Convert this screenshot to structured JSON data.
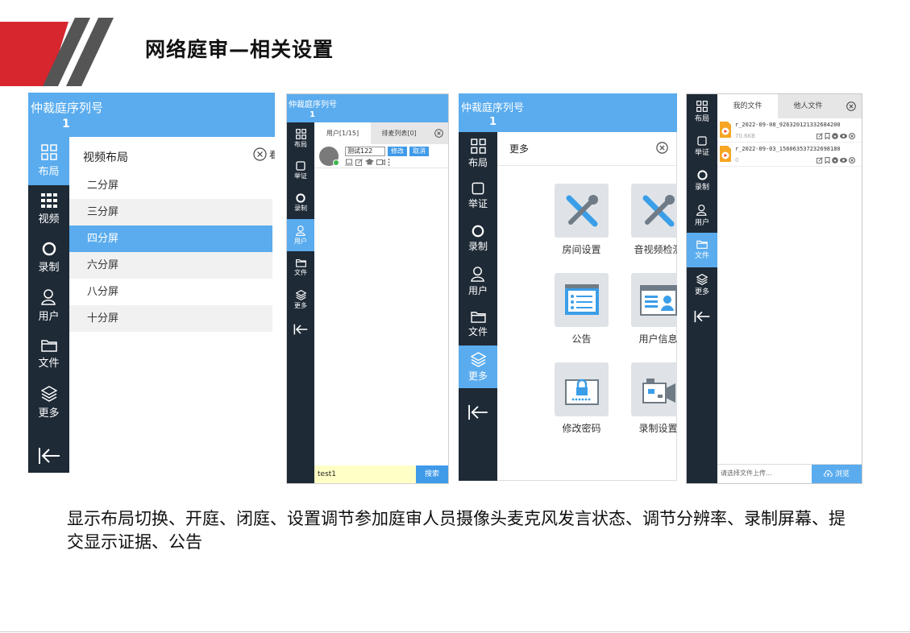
{
  "slide": {
    "title": "网络庭审—相关设置",
    "caption": "显示布局切换、开庭、闭庭、设置调节参加庭审人员摄像头麦克风发言状态、调节分辨率、录制屏幕、提交显示证据、公告",
    "accent_red": "#d7262e",
    "accent_gray": "#555555"
  },
  "p1": {
    "header_title": "仲裁庭序列号",
    "header_number": "1",
    "nav": [
      "布局",
      "视频",
      "录制",
      "用户",
      "文件",
      "更多"
    ],
    "panel_title": "视频布局",
    "options": [
      "二分屏",
      "三分屏",
      "四分屏",
      "六分屏",
      "八分屏",
      "十分屏"
    ],
    "selected": "四分屏",
    "partial": "看"
  },
  "p2": {
    "header_title": "仲裁庭序列号",
    "header_number": "1",
    "nav": [
      "布局",
      "举证",
      "录制",
      "用户",
      "文件",
      "更多"
    ],
    "tab_users": "用户[1/15]",
    "tab_queue": "排麦列表[0]",
    "user_name": "测试122",
    "modify": "修改",
    "cancel": "取消",
    "search_value": "test1",
    "search_btn": "搜索"
  },
  "p3": {
    "header_title": "仲裁庭序列号",
    "header_number": "1",
    "nav": [
      "布局",
      "举证",
      "录制",
      "用户",
      "文件",
      "更多"
    ],
    "panel_title": "更多",
    "tiles": [
      "房间设置",
      "音视频检测",
      "公告",
      "用户信息",
      "修改密码",
      "录制设置"
    ]
  },
  "p4": {
    "nav": [
      "布局",
      "举证",
      "录制",
      "用户",
      "文件",
      "更多"
    ],
    "tab_mine": "我的文件",
    "tab_others": "他人文件",
    "files": [
      {
        "name": "r_2022-09-08_926320121332684200",
        "size": "70.6KB"
      },
      {
        "name": "r_2022-09-03_156063537232698180",
        "size": "0"
      }
    ],
    "upload_placeholder": "请选择文件上传...",
    "browse": "浏览"
  },
  "colors": {
    "blue": "#5aacee",
    "dark": "#1e2a36",
    "button": "#3f9ae8"
  }
}
